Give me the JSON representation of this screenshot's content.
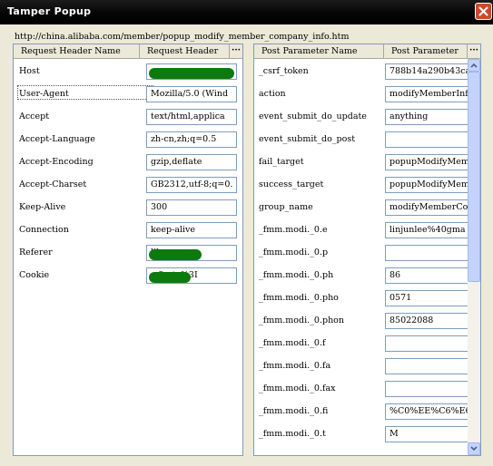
{
  "window": {
    "title": "Tamper Popup"
  },
  "url": "http://china.alibaba.com/member/popup_modify_member_company_info.htm",
  "request_headers": {
    "name_column": "Request Header Name",
    "value_column": "Request Header",
    "more": "···",
    "rows": [
      {
        "name": "Host",
        "value": ""
      },
      {
        "name": "User-Agent",
        "value": "Mozilla/5.0 (Wind"
      },
      {
        "name": "Accept",
        "value": "text/html,applica"
      },
      {
        "name": "Accept-Language",
        "value": "zh-cn,zh;q=0.5"
      },
      {
        "name": "Accept-Encoding",
        "value": "gzip,deflate"
      },
      {
        "name": "Accept-Charset",
        "value": "GB2312,utf-8;q=0."
      },
      {
        "name": "Keep-Alive",
        "value": "300"
      },
      {
        "name": "Connection",
        "value": "keep-alive"
      },
      {
        "name": "Referer",
        "value": "lib"
      },
      {
        "name": "Cookie",
        "value": "=firstv%3I"
      }
    ]
  },
  "post_parameters": {
    "name_column": "Post Parameter Name",
    "value_column": "Post Parameter",
    "more": "···",
    "rows": [
      {
        "name": "_csrf_token",
        "value": "788b14a290b43ca"
      },
      {
        "name": "action",
        "value": "modifyMemberInf"
      },
      {
        "name": "event_submit_do_update",
        "value": "anything"
      },
      {
        "name": "event_submit_do_post",
        "value": ""
      },
      {
        "name": "fail_target",
        "value": "popupModifyMemb"
      },
      {
        "name": "success_target",
        "value": "popupModifyMemb"
      },
      {
        "name": "group_name",
        "value": "modifyMemberCom"
      },
      {
        "name": "_fmm.modi._0.e",
        "value": "linjunlee%40gma"
      },
      {
        "name": "_fmm.modi._0.p",
        "value": ""
      },
      {
        "name": "_fmm.modi._0.ph",
        "value": "86"
      },
      {
        "name": "_fmm.modi._0.pho",
        "value": "0571"
      },
      {
        "name": "_fmm.modi._0.phon",
        "value": "85022088"
      },
      {
        "name": "_fmm.modi._0.f",
        "value": ""
      },
      {
        "name": "_fmm.modi._0.fa",
        "value": ""
      },
      {
        "name": "_fmm.modi._0.fax",
        "value": ""
      },
      {
        "name": "_fmm.modi._0.fi",
        "value": "%C0%EE%C6%E6"
      },
      {
        "name": "_fmm.modi._0.t",
        "value": "M"
      }
    ]
  },
  "colors": {
    "redaction": "#0d7a0d",
    "titlebar": "#000000"
  },
  "icons": {
    "close": "close-icon",
    "scroll_up": "arrow-up-icon",
    "scroll_down": "arrow-down-icon"
  }
}
